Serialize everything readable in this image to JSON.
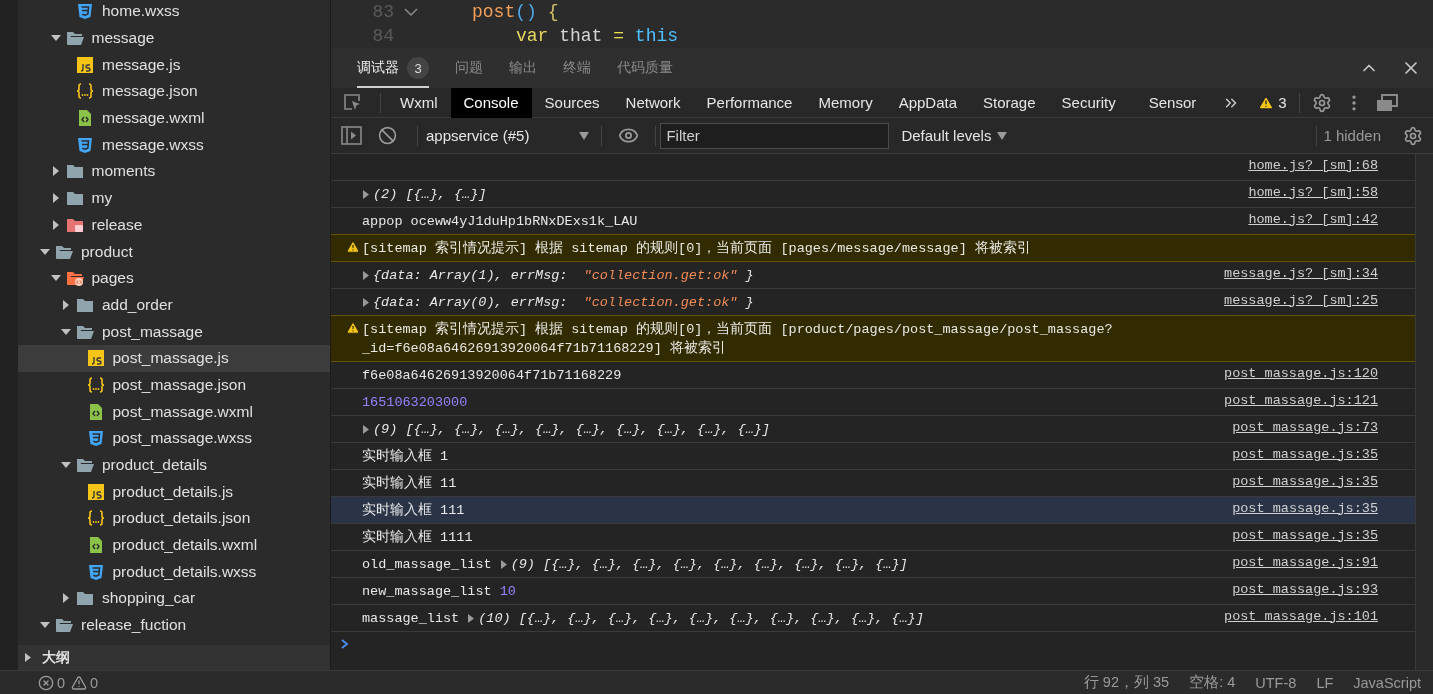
{
  "sidebar": {
    "tree": [
      {
        "children": [
          {
            "children": [
              {
                "name": "home.wxss",
                "kind": "wxss",
                "selected": false
              }
            ]
          },
          {
            "name": "message",
            "kind": "folder",
            "expanded": true,
            "selected": false,
            "children": [
              {
                "name": "message.js",
                "kind": "js",
                "selected": false
              },
              {
                "name": "message.json",
                "kind": "json",
                "selected": false
              },
              {
                "name": "message.wxml",
                "kind": "wxml",
                "selected": false
              },
              {
                "name": "message.wxss",
                "kind": "wxss",
                "selected": false
              }
            ]
          },
          {
            "name": "moments",
            "kind": "folder",
            "expanded": false,
            "selected": false
          },
          {
            "name": "my",
            "kind": "folder",
            "expanded": false,
            "selected": false
          },
          {
            "name": "release",
            "kind": "bagfolder",
            "expanded": false,
            "selected": false
          }
        ]
      },
      {
        "name": "product",
        "kind": "folder",
        "expanded": true,
        "selected": false,
        "children": [
          {
            "name": "pages",
            "kind": "codefolder",
            "expanded": true,
            "selected": false,
            "children": [
              {
                "name": "add_order",
                "kind": "folder",
                "expanded": false,
                "selected": false
              },
              {
                "name": "post_massage",
                "kind": "folder",
                "expanded": true,
                "selected": false,
                "children": [
                  {
                    "name": "post_massage.js",
                    "kind": "js",
                    "selected": true
                  },
                  {
                    "name": "post_massage.json",
                    "kind": "json",
                    "selected": false
                  },
                  {
                    "name": "post_massage.wxml",
                    "kind": "wxml",
                    "selected": false
                  },
                  {
                    "name": "post_massage.wxss",
                    "kind": "wxss",
                    "selected": false
                  }
                ]
              },
              {
                "name": "product_details",
                "kind": "folder",
                "expanded": true,
                "selected": false,
                "children": [
                  {
                    "name": "product_details.js",
                    "kind": "js",
                    "selected": false
                  },
                  {
                    "name": "product_details.json",
                    "kind": "json",
                    "selected": false
                  },
                  {
                    "name": "product_details.wxml",
                    "kind": "wxml",
                    "selected": false
                  },
                  {
                    "name": "product_details.wxss",
                    "kind": "wxss",
                    "selected": false
                  }
                ]
              },
              {
                "name": "shopping_car",
                "kind": "folder",
                "expanded": false,
                "selected": false
              }
            ]
          }
        ]
      },
      {
        "name": "release_fuction",
        "kind": "folder",
        "expanded": true,
        "selected": false
      }
    ],
    "outline": {
      "title": "大纲",
      "expanded": false
    }
  },
  "editor": {
    "lines": [
      {
        "number": "83",
        "kind": "head",
        "tokens": [
          {
            "kind": "fn",
            "text": "post"
          },
          {
            "kind": "paren",
            "text": "()"
          },
          {
            "kind": "brace",
            "text": "{"
          }
        ]
      },
      {
        "number": "84",
        "kind": "body",
        "tokens": [
          {
            "kind": "keyword",
            "text": "var"
          },
          {
            "kind": "plain",
            "text": "that"
          },
          {
            "kind": "op",
            "text": "="
          },
          {
            "kind": "this",
            "text": "this"
          }
        ]
      }
    ]
  },
  "panel_tabs": [
    {
      "label": "调试器",
      "badge": "3",
      "selected": true
    },
    {
      "label": "问题",
      "selected": false
    },
    {
      "label": "输出",
      "selected": false
    },
    {
      "label": "终端",
      "selected": false
    },
    {
      "label": "代码质量",
      "selected": false
    }
  ],
  "devtools": {
    "tabs": [
      {
        "label": "Wxml",
        "selected": false
      },
      {
        "label": "Console",
        "selected": true
      },
      {
        "label": "Sources",
        "selected": false
      },
      {
        "label": "Network",
        "selected": false
      },
      {
        "label": "Performance",
        "selected": false
      },
      {
        "label": "Memory",
        "selected": false
      },
      {
        "label": "AppData",
        "selected": false
      },
      {
        "label": "Storage",
        "selected": false
      },
      {
        "label": "Security",
        "selected": false
      },
      {
        "label": "Sensor",
        "selected": false
      }
    ],
    "warning_count": "3"
  },
  "console": {
    "context": "appservice (#5)",
    "filter": {
      "placeholder": "Filter"
    },
    "levels": "Default levels",
    "hidden": "1 hidden",
    "messages": [
      {
        "kind": "log",
        "highlighted": false,
        "source": "home.js? [sm]:68"
      },
      {
        "kind": "log",
        "highlighted": false,
        "content": [
          {
            "kind": "object",
            "text": "(2) [{…}, {…}]"
          }
        ],
        "source": "home.js? [sm]:58"
      },
      {
        "kind": "log",
        "highlighted": false,
        "content": [
          {
            "kind": "text",
            "text": "appop oceww4yJ1duHp1bRNxDExs1k_LAU"
          }
        ],
        "source": "home.js? [sm]:42"
      },
      {
        "kind": "warning",
        "highlighted": false,
        "content": [
          {
            "kind": "text",
            "text": "[sitemap 索引情况提示] 根据 sitemap 的规则[0]，当前页面 [pages/message/message] 将被索引"
          }
        ]
      },
      {
        "kind": "log",
        "highlighted": false,
        "content": [
          {
            "kind": "object",
            "text": "{data: Array(1), errMsg: "
          },
          {
            "kind": "string",
            "text": "\"collection.get:ok\""
          },
          {
            "kind": "italic",
            "text": "}"
          }
        ],
        "source": "message.js? [sm]:34"
      },
      {
        "kind": "log",
        "highlighted": false,
        "content": [
          {
            "kind": "object",
            "text": "{data: Array(0), errMsg: "
          },
          {
            "kind": "string",
            "text": "\"collection.get:ok\""
          },
          {
            "kind": "italic",
            "text": "}"
          }
        ],
        "source": "message.js? [sm]:25"
      },
      {
        "kind": "warning",
        "highlighted": false,
        "content": [
          {
            "kind": "text",
            "text": "[sitemap 索引情况提示] 根据 sitemap 的规则[0]，当前页面 [product/pages/post_massage/post_massage? _id=f6e08a64626913920064f71b71168229] 将被索引"
          }
        ]
      },
      {
        "kind": "log",
        "highlighted": false,
        "content": [
          {
            "kind": "text",
            "text": "f6e08a64626913920064f71b71168229"
          }
        ],
        "source": "post_massage.js:120"
      },
      {
        "kind": "log",
        "highlighted": false,
        "content": [
          {
            "kind": "number",
            "text": "1651063203000"
          }
        ],
        "source": "post_massage.js:121"
      },
      {
        "kind": "log",
        "highlighted": false,
        "content": [
          {
            "kind": "object",
            "text": "(9) [{…}, {…}, {…}, {…}, {…}, {…}, {…}, {…}, {…}]"
          }
        ],
        "source": "post_massage.js:73"
      },
      {
        "kind": "log",
        "highlighted": false,
        "content": [
          {
            "kind": "text",
            "text": "实时输入框 1"
          }
        ],
        "source": "post_massage.js:35"
      },
      {
        "kind": "log",
        "highlighted": false,
        "content": [
          {
            "kind": "text",
            "text": "实时输入框 11"
          }
        ],
        "source": "post_massage.js:35"
      },
      {
        "kind": "log",
        "highlighted": true,
        "content": [
          {
            "kind": "text",
            "text": "实时输入框 111"
          }
        ],
        "source": "post_massage.js:35"
      },
      {
        "kind": "log",
        "highlighted": false,
        "content": [
          {
            "kind": "text",
            "text": "实时输入框 1111"
          }
        ],
        "source": "post_massage.js:35"
      },
      {
        "kind": "log",
        "highlighted": false,
        "content": [
          {
            "kind": "text",
            "text": "old_massage_list"
          },
          {
            "kind": "object",
            "text": "(9) [{…}, {…}, {…}, {…}, {…}, {…}, {…}, {…}, {…}]"
          }
        ],
        "source": "post_massage.js:91"
      },
      {
        "kind": "log",
        "highlighted": false,
        "content": [
          {
            "kind": "text",
            "text": "new_massage_list"
          },
          {
            "kind": "number",
            "text": "10"
          }
        ],
        "source": "post_massage.js:93"
      },
      {
        "kind": "log",
        "highlighted": false,
        "content": [
          {
            "kind": "text",
            "text": "massage_list"
          },
          {
            "kind": "object",
            "text": "(10) [{…}, {…}, {…}, {…}, {…}, {…}, {…}, {…}, {…}, {…}]"
          }
        ],
        "source": "post_massage.js:101"
      }
    ]
  },
  "status_bar": {
    "errors": "0",
    "warnings": "0",
    "items": [
      "行 92，列 35",
      "空格: 4",
      "UTF-8",
      "LF",
      "JavaScript"
    ]
  }
}
